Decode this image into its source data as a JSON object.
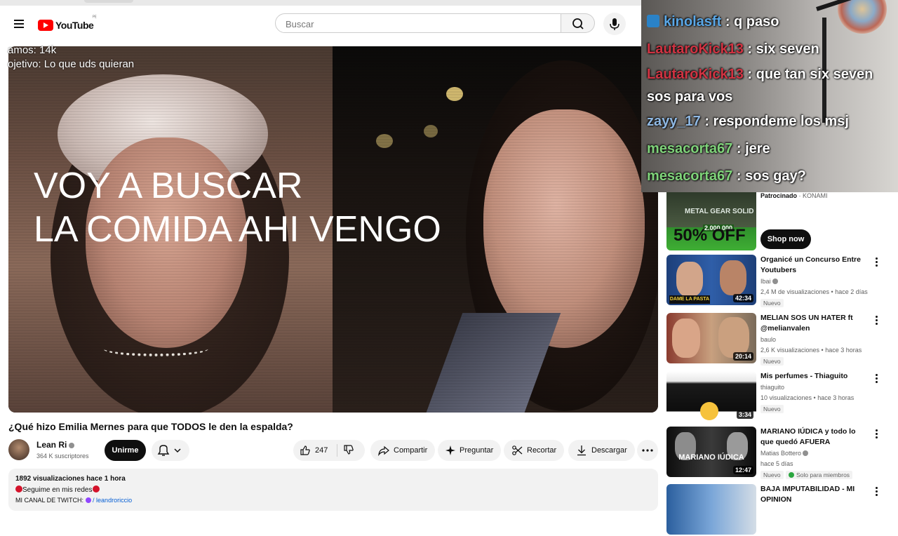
{
  "header": {
    "logo_text": "YouTube",
    "logo_suffix": "ᴾᴱ",
    "search_placeholder": "Buscar"
  },
  "player": {
    "stats_line1": "amos: 14k",
    "stats_line2": "ojetivo: Lo que uds quieran",
    "overlay_line1": "VOY  A BUSCAR",
    "overlay_line2": "LA COMIDA AHI VENGO"
  },
  "video": {
    "title": "¿Qué hizo Emilia Mernes para que TODOS le den la espalda?",
    "channel": "Lean Ri",
    "subscribers": "364 K suscriptores",
    "join_label": "Unirme",
    "likes": "247",
    "share_label": "Compartir",
    "ask_label": "Preguntar",
    "clip_label": "Recortar",
    "download_label": "Descargar"
  },
  "description": {
    "views_time": "1892 visualizaciones  hace 1 hora",
    "line2": "Seguime en mis redes",
    "line3_prefix": "MI CANAL DE TWITCH:",
    "line3_link": "/ leandroriccio"
  },
  "chat": {
    "messages": [
      {
        "user": "kinolasft",
        "text": ": q paso",
        "color": "#5aa7e6"
      },
      {
        "user": "LautaroKick13",
        "text": ": six seven",
        "color": "#d03342"
      },
      {
        "user": "LautaroKick13",
        "text": ": que tan six seven sos para vos",
        "color": "#d03342"
      },
      {
        "user": "zayy_17",
        "text": ": respondeme los msj",
        "color": "#8fb8e3"
      },
      {
        "user": "mesacorta67",
        "text": ": jere",
        "color": "#7fd37a"
      },
      {
        "user": "mesacorta67",
        "text": ": sos gay?",
        "color": "#7fd37a"
      }
    ]
  },
  "sidebar": {
    "ad": {
      "thumb_title": "METAL GEAR SOLID",
      "thumb_count": "2.000.000",
      "thumb_offer": "50% OFF",
      "sponsor_label": "Patrocinado",
      "sponsor_name": "KONAMI",
      "cta": "Shop now"
    },
    "recommendations": [
      {
        "title": "Organicé un Concurso Entre Youtubers",
        "channel": "Ibai",
        "meta": "2,4 M de visualizaciones • hace 2 días",
        "badge": "Nuevo",
        "duration": "42:34"
      },
      {
        "title": "MELIAN SOS UN HATER ft @melianvalen",
        "channel": "baulo",
        "meta": "2,6 K visualizaciones • hace 3 horas",
        "badge": "Nuevo",
        "duration": "20:14"
      },
      {
        "title": "Mis perfumes - Thiaguito",
        "channel": "thiaguito",
        "meta": "10 visualizaciones • hace 3 horas",
        "badge": "Nuevo",
        "duration": "3:34"
      },
      {
        "title": "MARIANO IÚDICA y todo lo que quedó AFUERA",
        "channel": "Matias Bottero",
        "meta": "hace 5 días",
        "badge": "Nuevo",
        "badge2": "Solo para miembros",
        "duration": "12:47"
      },
      {
        "title": "BAJA IMPUTABILIDAD - MI OPINION",
        "channel": "",
        "meta": "",
        "badge": "",
        "duration": ""
      }
    ]
  }
}
